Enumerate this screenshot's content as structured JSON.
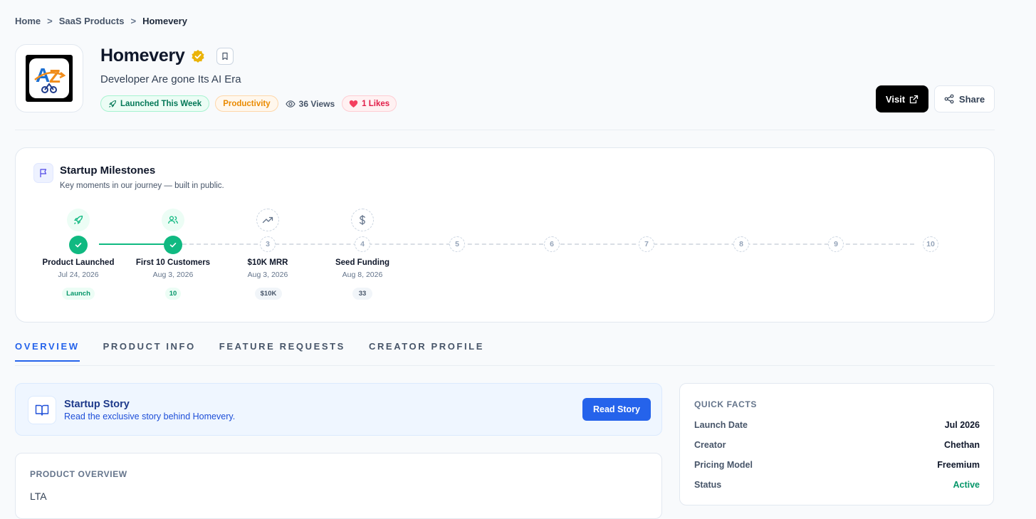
{
  "breadcrumb": {
    "items": [
      "Home",
      "SaaS Products",
      "Homevery"
    ],
    "separator": ">"
  },
  "product": {
    "name": "Homevery",
    "tagline": "Developer Are gone Its AI Era",
    "logo_text": "AZ",
    "badges": {
      "launch": "Launched This Week",
      "category": "Productivity",
      "views": "36 Views",
      "likes": "1 Likes"
    }
  },
  "actions": {
    "visit": "Visit",
    "share": "Share"
  },
  "milestones": {
    "title": "Startup Milestones",
    "subtitle": "Key moments in our journey — built in public.",
    "items": [
      {
        "label": "Product Launched",
        "date": "Jul 24, 2026",
        "chip": "Launch",
        "done": true,
        "icon": "rocket-icon"
      },
      {
        "label": "First 10 Customers",
        "date": "Aug 3, 2026",
        "chip": "10",
        "done": true,
        "icon": "users-icon"
      },
      {
        "label": "$10K MRR",
        "date": "Aug 3, 2026",
        "chip": "$10K",
        "done": false,
        "number": "3",
        "icon": "trending-up-icon"
      },
      {
        "label": "Seed Funding",
        "date": "Aug 8, 2026",
        "chip": "33",
        "done": false,
        "number": "4",
        "icon": "dollar-icon"
      }
    ],
    "future_steps": [
      "5",
      "6",
      "7",
      "8",
      "9",
      "10"
    ]
  },
  "tabs": [
    {
      "label": "OVERVIEW",
      "active": true
    },
    {
      "label": "PRODUCT INFO",
      "active": false
    },
    {
      "label": "FEATURE REQUESTS",
      "active": false
    },
    {
      "label": "CREATOR PROFILE",
      "active": false
    }
  ],
  "story": {
    "title": "Startup Story",
    "subtitle": "Read the exclusive story behind Homevery.",
    "button": "Read Story"
  },
  "overview": {
    "heading": "PRODUCT OVERVIEW",
    "body": "LTA"
  },
  "quick_facts": {
    "heading": "QUICK FACTS",
    "rows": [
      {
        "key": "Launch Date",
        "value": "Jul 2026"
      },
      {
        "key": "Creator",
        "value": "Chethan"
      },
      {
        "key": "Pricing Model",
        "value": "Freemium"
      },
      {
        "key": "Status",
        "value": "Active"
      }
    ]
  },
  "colors": {
    "accent": "#2563eb",
    "success": "#10b981",
    "verified": "#eab308",
    "like": "#e11d48"
  }
}
